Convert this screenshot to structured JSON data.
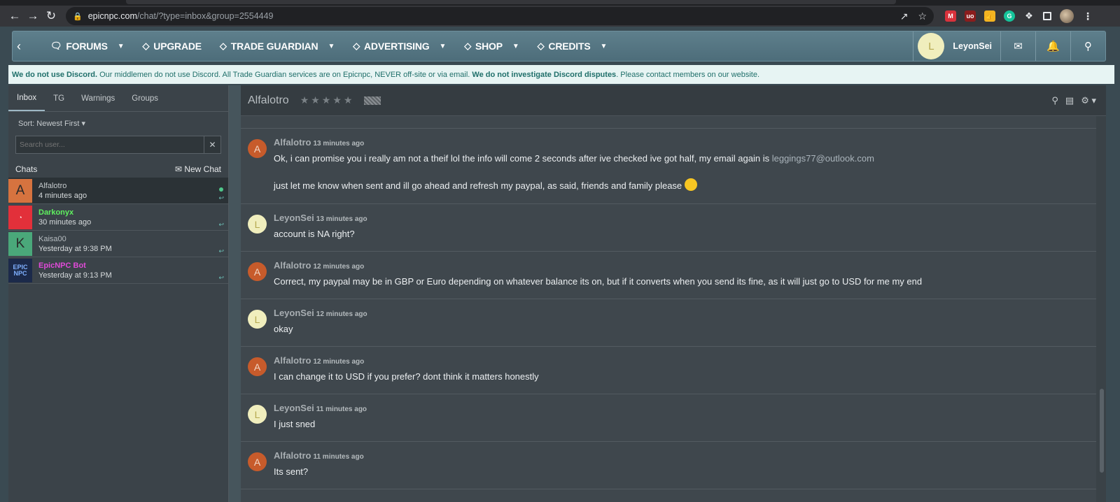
{
  "browser": {
    "url_host": "epicnpc.com",
    "url_path": "/chat/?type=inbox&group=2554449"
  },
  "topnav": {
    "items": [
      {
        "label": "FORUMS",
        "icon": "chat-icon",
        "caret": true
      },
      {
        "label": "UPGRADE",
        "icon": "tag-icon",
        "caret": false
      },
      {
        "label": "TRADE GUARDIAN",
        "icon": "tag-icon",
        "caret": true
      },
      {
        "label": "ADVERTISING",
        "icon": "tag-icon",
        "caret": true
      },
      {
        "label": "SHOP",
        "icon": "tag-icon",
        "caret": true
      },
      {
        "label": "CREDITS",
        "icon": "tag-icon",
        "caret": true
      }
    ],
    "user": {
      "initial": "L",
      "name": "LeyonSei"
    }
  },
  "notice": {
    "bold1": "We do not use Discord.",
    "text1": " Our middlemen do not use Discord. All Trade Guardian services are on Epicnpc, NEVER off-site or via email. ",
    "bold2": "We do not investigate Discord disputes",
    "text2": ". Please contact members on our website."
  },
  "sidebar": {
    "tabs": [
      "Inbox",
      "TG",
      "Warnings",
      "Groups"
    ],
    "sort_label": "Sort: Newest First",
    "search_placeholder": "Search user...",
    "chats_label": "Chats",
    "new_chat_label": "New Chat",
    "chats": [
      {
        "name": "Alfalotro",
        "time": "4 minutes ago",
        "initial": "A",
        "avatar_color": "#d6733f",
        "name_color": "#c5cacd",
        "online": true
      },
      {
        "name": "Darkonyx",
        "time": "30 minutes ago",
        "initial": "",
        "avatar_color": "#e2303a",
        "name_color": "#5ff05f",
        "online": false
      },
      {
        "name": "Kaisa00",
        "time": "Yesterday at 9:38 PM",
        "initial": "K",
        "avatar_color": "#4aa87a",
        "name_color": "#b6bcc0",
        "online": false
      },
      {
        "name": "EpicNPC Bot",
        "time": "Yesterday at 9:13 PM",
        "initial": "",
        "avatar_color": "#1c2a4a",
        "name_color": "#e04ad8",
        "online": false
      }
    ]
  },
  "main": {
    "title": "Alfalotro",
    "messages": [
      {
        "who": "Alfalotro",
        "initial": "A",
        "kind": "a",
        "when": "13 minutes ago",
        "lines": [
          "Ok, i can promise you i really am not a theif lol the info will come 2 seconds after ive checked ive got half, my email again is ",
          "just let me know when sent and ill go ahead and refresh my paypal, as said, friends and family please "
        ],
        "email": "leggings77@outlook.com"
      },
      {
        "who": "LeyonSei",
        "initial": "L",
        "kind": "l",
        "when": "13 minutes ago",
        "lines": [
          "account is NA right?"
        ]
      },
      {
        "who": "Alfalotro",
        "initial": "A",
        "kind": "a",
        "when": "12 minutes ago",
        "lines": [
          "Correct, my paypal may be in GBP or Euro depending on whatever balance its on, but if it converts when you send its fine, as it will just go to USD for me my end"
        ]
      },
      {
        "who": "LeyonSei",
        "initial": "L",
        "kind": "l",
        "when": "12 minutes ago",
        "lines": [
          "okay"
        ]
      },
      {
        "who": "Alfalotro",
        "initial": "A",
        "kind": "a",
        "when": "12 minutes ago",
        "lines": [
          "I can change it to USD if you prefer? dont think it matters honestly"
        ]
      },
      {
        "who": "LeyonSei",
        "initial": "L",
        "kind": "l",
        "when": "11 minutes ago",
        "lines": [
          "I just sned"
        ]
      },
      {
        "who": "Alfalotro",
        "initial": "A",
        "kind": "a",
        "when": "11 minutes ago",
        "lines": [
          "Its sent?"
        ]
      }
    ]
  }
}
